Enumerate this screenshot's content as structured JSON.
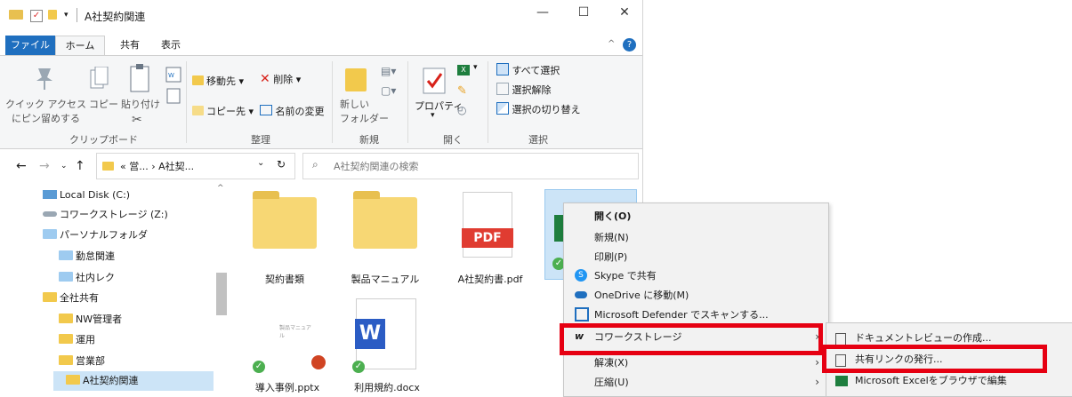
{
  "window": {
    "title": "A社契約関連",
    "minimize": "—",
    "maximize": "☐",
    "close": "✕"
  },
  "ribbon_tabs": {
    "file": "ファイル",
    "home": "ホーム",
    "share": "共有",
    "view": "表示"
  },
  "ribbon": {
    "pin_quick_access": [
      "クイック アクセス",
      "にピン留めする"
    ],
    "copy": "コピー",
    "paste": "貼り付け",
    "move_to": "移動先",
    "copy_to": "コピー先",
    "delete": "削除",
    "rename": "名前の変更",
    "new_folder": [
      "新しい",
      "フォルダー"
    ],
    "properties": "プロパティ",
    "select_all": "すべて選択",
    "select_none": "選択解除",
    "invert_selection": "選択の切り替え",
    "groups": {
      "clipboard": "クリップボード",
      "organize": "整理",
      "new": "新規",
      "open": "開く",
      "select": "選択"
    }
  },
  "address": {
    "path": "« 営... › A社契...",
    "search_placeholder": "A社契約関連の検索"
  },
  "nav": {
    "items": [
      {
        "label": "Local Disk (C:)"
      },
      {
        "label": "コワークストレージ (Z:)"
      },
      {
        "label": "パーソナルフォルダ"
      },
      {
        "label": "勤怠関連"
      },
      {
        "label": "社内レク"
      },
      {
        "label": "全社共有"
      },
      {
        "label": "NW管理者"
      },
      {
        "label": "運用"
      },
      {
        "label": "営業部"
      },
      {
        "label": "A社契約関連"
      }
    ]
  },
  "files": [
    {
      "name": "契約書類"
    },
    {
      "name": "製品マニュアル"
    },
    {
      "name": "A社契約書.pdf",
      "badge": "PDF"
    },
    {
      "name": "導入事例.pptx"
    },
    {
      "name": "利用規約.docx",
      "badge": "W"
    }
  ],
  "context_menu": {
    "items": [
      {
        "label": "開く(O)"
      },
      {
        "label": "新規(N)"
      },
      {
        "label": "印刷(P)"
      },
      {
        "label": "Skype で共有"
      },
      {
        "label": "OneDrive に移動(M)"
      },
      {
        "label": "Microsoft Defender でスキャンする..."
      },
      {
        "label": "コワークストレージ"
      },
      {
        "label": "解凍(X)"
      },
      {
        "label": "圧縮(U)"
      }
    ]
  },
  "submenu": {
    "items": [
      {
        "label": "ドキュメントレビューの作成..."
      },
      {
        "label": "共有リンクの発行..."
      },
      {
        "label": "Microsoft Excelをブラウザで編集"
      }
    ]
  },
  "colors": {
    "accent": "#1f6fbf",
    "highlight": "#e60012",
    "folder": "#f2c94c",
    "check": "#4caf50"
  }
}
